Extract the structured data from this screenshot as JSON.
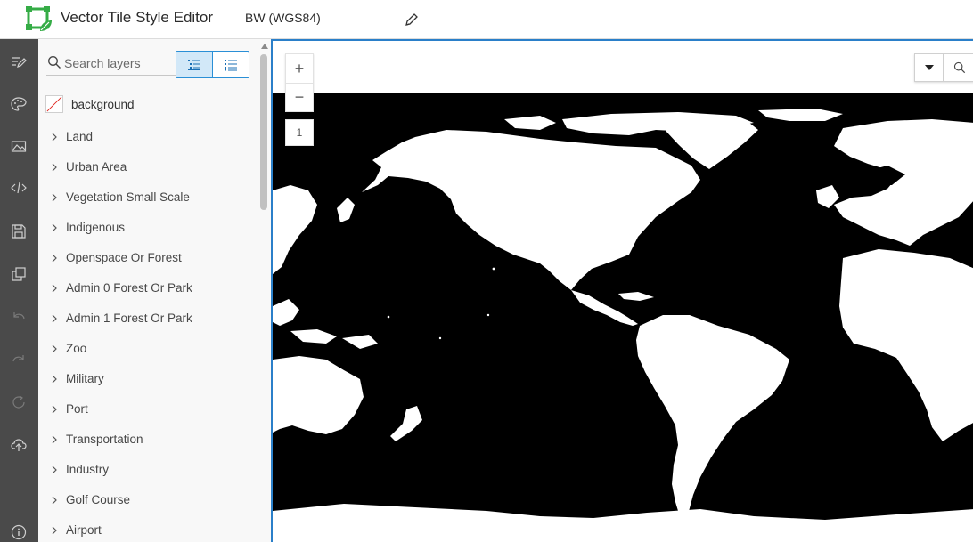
{
  "header": {
    "app_title": "Vector Tile Style Editor",
    "style_name": "BW (WGS84)"
  },
  "rail": {
    "icons": [
      "edit-style-icon",
      "paint-palette-icon",
      "image-icon",
      "code-icon",
      "save-icon",
      "duplicate-icon",
      "undo-icon",
      "redo-icon",
      "reset-icon",
      "upload-icon",
      "info-icon"
    ]
  },
  "panel": {
    "search": {
      "placeholder": "Search layers",
      "value": ""
    },
    "background_layer": {
      "label": "background",
      "color": "#ffffff"
    },
    "layers": [
      "Land",
      "Urban Area",
      "Vegetation Small Scale",
      "Indigenous",
      "Openspace Or Forest",
      "Admin 0 Forest Or Park",
      "Admin 1 Forest Or Park",
      "Zoo",
      "Military",
      "Port",
      "Transportation",
      "Industry",
      "Golf Course",
      "Airport"
    ]
  },
  "map": {
    "zoom_in": "+",
    "zoom_out": "−",
    "zoom_level": "1",
    "water_color": "#000000",
    "land_color": "#ffffff"
  },
  "colors": {
    "accent": "#2a8fd6",
    "rail_bg": "#4a4a4a",
    "logo_green": "#35ac46"
  }
}
